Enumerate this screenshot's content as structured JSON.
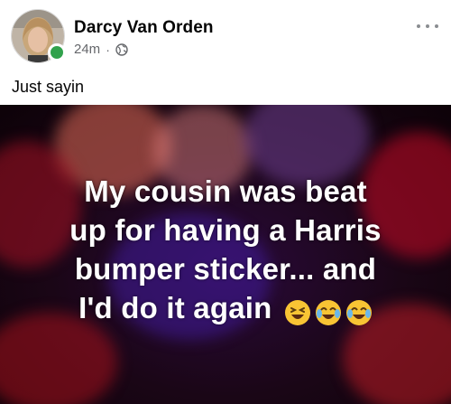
{
  "post": {
    "author_name": "Darcy Van Orden",
    "timestamp": "24m",
    "separator": "·",
    "privacy_icon": "globe-icon",
    "more_icon": "more-horizontal-icon",
    "caption": "Just sayin",
    "online_status_color": "#31a24c"
  },
  "meme": {
    "lines": [
      "My cousin was beat",
      "up for having a Harris",
      "bumper sticker... and",
      "I'd do it again"
    ],
    "emojis": [
      "laughing-squint-emoji",
      "tears-of-joy-emoji",
      "tears-of-joy-emoji"
    ]
  }
}
